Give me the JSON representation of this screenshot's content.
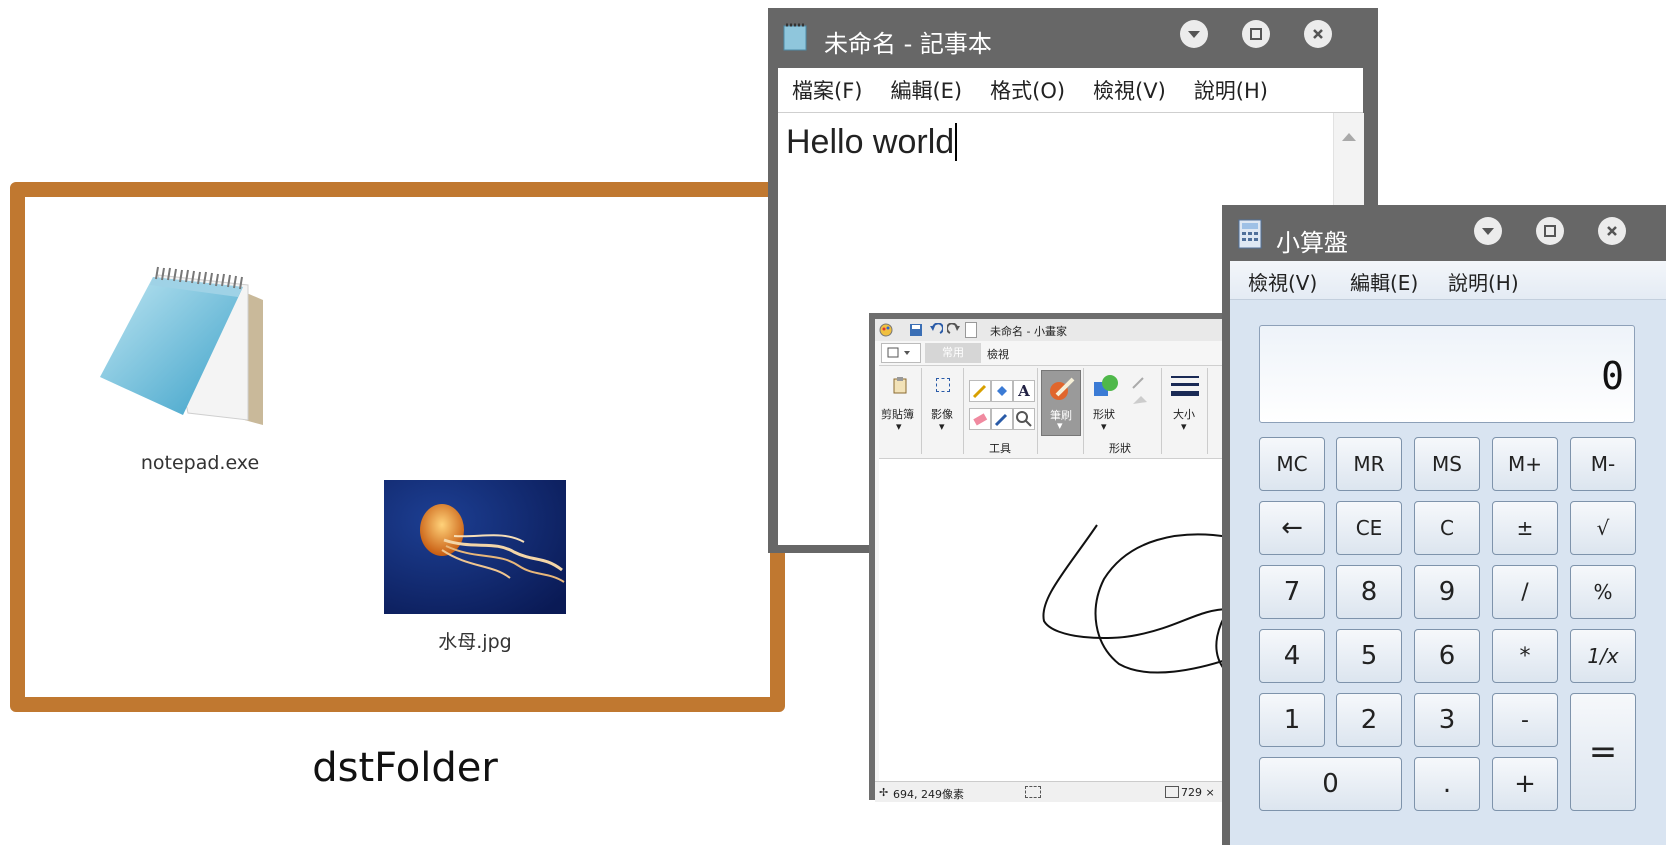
{
  "folder": {
    "caption": "dstFolder",
    "files": [
      {
        "name": "notepad.exe",
        "icon": "notepad-icon"
      },
      {
        "name": "水母.jpg",
        "icon": "jellyfish-thumbnail"
      }
    ]
  },
  "notepad": {
    "title": "未命名 - 記事本",
    "menu": [
      "檔案(F)",
      "編輯(E)",
      "格式(O)",
      "檢視(V)",
      "說明(H)"
    ],
    "text": "Hello world"
  },
  "paint": {
    "title": "未命名 - 小畫家",
    "tabs": [
      "常用",
      "檢視"
    ],
    "groups": {
      "clipboard": "剪貼簿",
      "image": "影像",
      "tools": "工具",
      "brush": "筆刷",
      "shapes_btn": "形狀",
      "shapes_group": "形狀",
      "size": "大小"
    },
    "status": {
      "coords": "694, 249像素",
      "size": "729 ×"
    }
  },
  "calculator": {
    "title": "小算盤",
    "menu": [
      "檢視(V)",
      "編輯(E)",
      "說明(H)"
    ],
    "display": "0",
    "keys": {
      "r1": [
        "MC",
        "MR",
        "MS",
        "M+",
        "M-"
      ],
      "r2": [
        "←",
        "CE",
        "C",
        "±",
        "√"
      ],
      "r3": [
        "7",
        "8",
        "9",
        "/",
        "%"
      ],
      "r4": [
        "4",
        "5",
        "6",
        "*",
        "1/x"
      ],
      "r5": [
        "1",
        "2",
        "3",
        "-"
      ],
      "r6": [
        "0",
        ".",
        "+"
      ],
      "equals": "="
    }
  },
  "colors": {
    "folder_border": "#c07830",
    "window_frame": "#676767",
    "calc_body": "#d9e4f1"
  }
}
